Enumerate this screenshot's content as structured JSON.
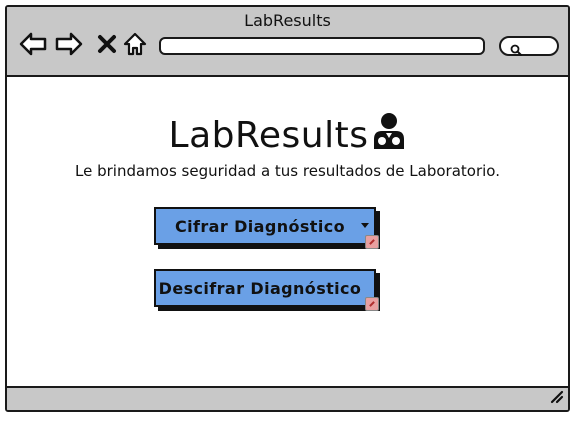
{
  "window": {
    "title": "LabResults"
  },
  "toolbar": {
    "icons": [
      "back-arrow-icon",
      "forward-arrow-icon",
      "close-icon",
      "home-icon"
    ],
    "address_value": "",
    "search_value": ""
  },
  "page": {
    "heading": "LabResults",
    "heading_icon": "doctor-icon",
    "tagline": "Le brindamos seguridad a tus resultados de Laboratorio."
  },
  "buttons": {
    "encrypt_label": "Cifrar Diagnóstico",
    "decrypt_label": "Descifrar Diagnóstico"
  },
  "colors": {
    "button_fill": "#6aa0e6",
    "chrome_gray": "#c8c8c8"
  }
}
